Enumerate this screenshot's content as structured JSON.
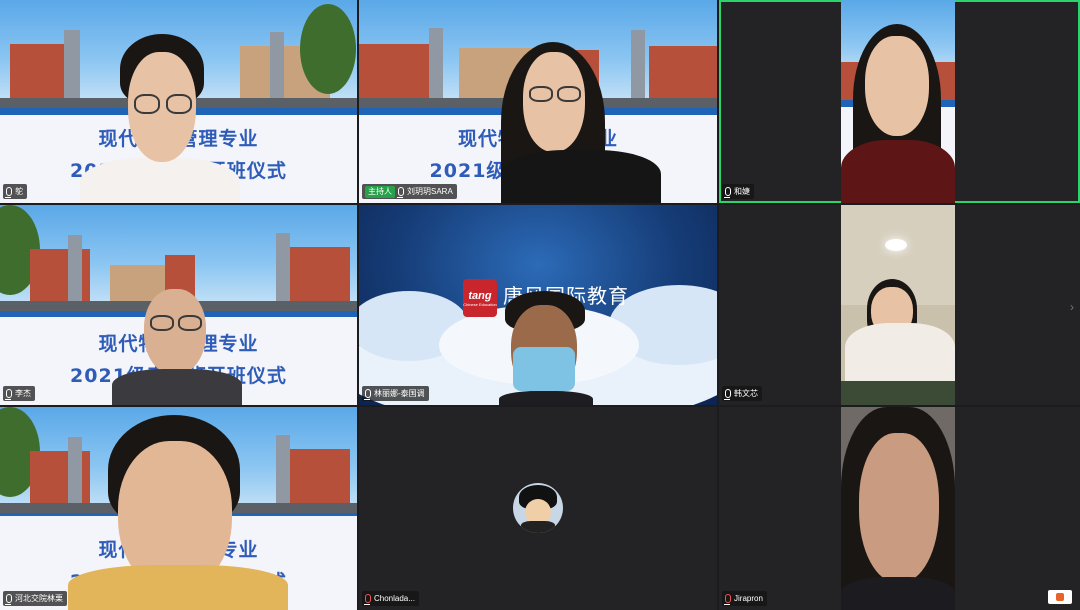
{
  "banner": {
    "line1_a": "现代物流管理专业",
    "line1_short": "现代物",
    "line1_rest": "专业",
    "line2": "2021级泰国班开班仪式",
    "line2_rest": "开班仪式"
  },
  "logo": {
    "mark": "tang",
    "sub": "Chinese Education",
    "cn": "唐风国际教育",
    "en": "Tang Chinese Education"
  },
  "participants": [
    {
      "name": "鸵"
    },
    {
      "name": "刘玥玥SARA",
      "role": "主持人"
    },
    {
      "name": "和婕"
    },
    {
      "name": "李杰"
    },
    {
      "name": "林丽娜-泰国调"
    },
    {
      "name": "韩文芯"
    },
    {
      "name": "河北交院林栗"
    },
    {
      "name": "Chonlada..."
    },
    {
      "name": "Jirapron"
    }
  ],
  "colors": {
    "active_speaker": "#2bd46a",
    "host_badge": "#27a24a",
    "banner_text": "#2e5cb8"
  }
}
